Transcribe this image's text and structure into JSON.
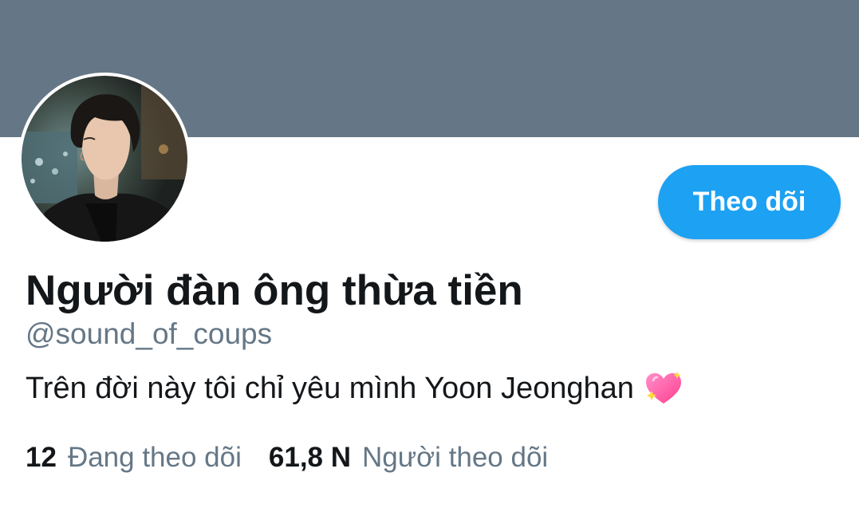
{
  "profile": {
    "display_name": "Người đàn ông thừa tiền",
    "handle": "@sound_of_coups",
    "bio": "Trên đời này tôi chỉ yêu mình Yoon Jeonghan",
    "bio_emoji": "sparkling-heart-icon",
    "follow_button_label": "Theo dõi"
  },
  "stats": {
    "following_count": "12",
    "following_label": "Đang theo dõi",
    "followers_count": "61,8 N",
    "followers_label": "Người theo dõi"
  },
  "colors": {
    "banner": "#657786",
    "accent": "#1da1f2",
    "primary_text": "#14171a",
    "secondary_text": "#657786",
    "emoji_heart": "#ff5fa8"
  }
}
